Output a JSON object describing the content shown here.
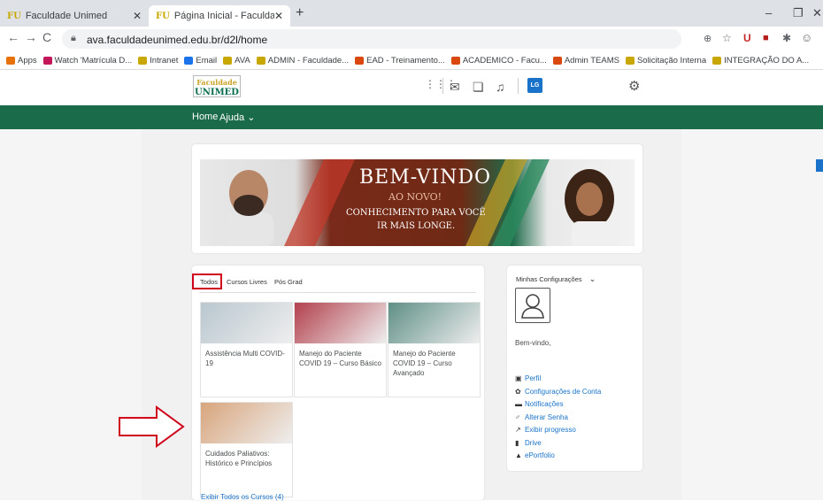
{
  "browser": {
    "tabs": [
      {
        "label": "Faculdade Unimed"
      },
      {
        "label": "Página Inicial - Faculdade Unime..."
      }
    ],
    "url": "ava.faculdadeunimed.edu.br/d2l/home",
    "bookmarks": [
      {
        "label": "Apps",
        "color": "#e8710a"
      },
      {
        "label": "Watch 'Matrícula D...",
        "color": "#c2185b"
      },
      {
        "label": "Intranet",
        "color": "#c8a800"
      },
      {
        "label": "Email",
        "color": "#1a73e8"
      },
      {
        "label": "AVA",
        "color": "#c8a800"
      },
      {
        "label": "ADMIN - Faculdade...",
        "color": "#c8a800"
      },
      {
        "label": "EAD - Treinamento...",
        "color": "#d9480f"
      },
      {
        "label": "ACADEMICO - Facu...",
        "color": "#d9480f"
      },
      {
        "label": "Admin TEAMS",
        "color": "#d9480f"
      },
      {
        "label": "Solicitação Interna",
        "color": "#c8a800"
      },
      {
        "label": "INTEGRAÇÃO DO A...",
        "color": "#c8a800"
      }
    ]
  },
  "header": {
    "logo_line1": "Faculdade",
    "logo_line2": "UNIMED",
    "user_initials": "LG"
  },
  "nav": {
    "home": "Home",
    "ajuda": "Ajuda ⌄"
  },
  "banner": {
    "title": "BEM-VINDO",
    "subtitle": "AO NOVO!",
    "line1": "CONHECIMENTO PARA VOCÊ",
    "line2": "IR MAIS LONGE."
  },
  "courses": {
    "tabs": [
      "Todos",
      "Cursos Livres",
      "Pós Grad"
    ],
    "items": [
      {
        "title": "Assistência Multi COVID-19",
        "color": "#b9c7cf"
      },
      {
        "title": "Manejo do Paciente COVID 19 – Curso Básico",
        "color": "#b3414d"
      },
      {
        "title": "Manejo do Paciente COVID 19 – Curso Avançado",
        "color": "#5f8f86"
      },
      {
        "title": "Cuidados Paliativos: Histórico e Princípios",
        "color": "#d8a57c"
      }
    ],
    "view_all": "Exibir Todos os Cursos (4)"
  },
  "config": {
    "title": "Minhas Configurações",
    "welcome": "Bem-vindo,",
    "links": [
      {
        "icon": "▣",
        "label": "Perfil"
      },
      {
        "icon": "✿",
        "label": "Configurações de Conta"
      },
      {
        "icon": "▬",
        "label": "Notificações"
      },
      {
        "icon": "♂",
        "label": "Alterar Senha"
      },
      {
        "icon": "↗",
        "label": "Exibir progresso"
      },
      {
        "icon": "▮",
        "label": "Drive"
      },
      {
        "icon": "▲",
        "label": "ePortfolio"
      }
    ]
  },
  "colors": {
    "brand_green": "#1a6b4a",
    "highlight_red": "#d0021b",
    "link_blue": "#1a73c8"
  }
}
